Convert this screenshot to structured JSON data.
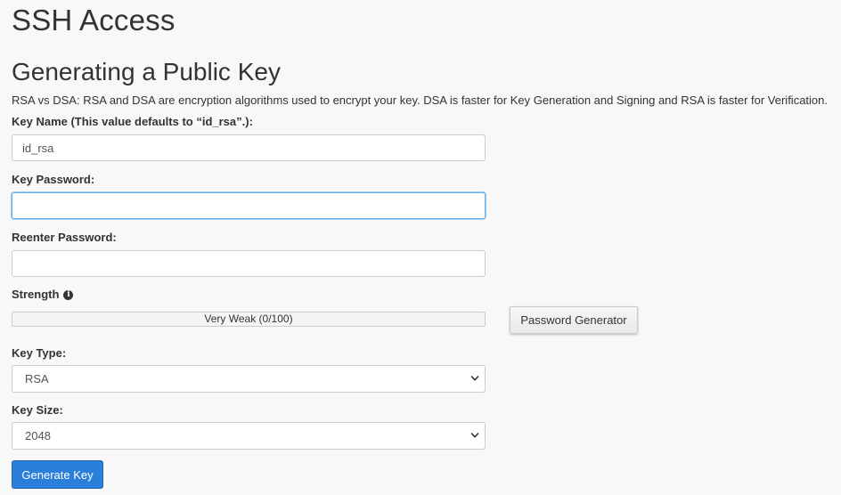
{
  "page": {
    "title": "SSH Access",
    "section_title": "Generating a Public Key",
    "description": "RSA vs DSA: RSA and DSA are encryption algorithms used to encrypt your key. DSA is faster for Key Generation and Signing and RSA is faster for Verification."
  },
  "form": {
    "key_name": {
      "label": "Key Name (This value defaults to “id_rsa”.):",
      "value": "id_rsa"
    },
    "key_password": {
      "label": "Key Password:",
      "value": ""
    },
    "reenter_password": {
      "label": "Reenter Password:",
      "value": ""
    },
    "strength": {
      "label": "Strength",
      "info_icon": "info-circle-icon",
      "meter_text": "Very Weak (0/100)",
      "score": 0,
      "max": 100
    },
    "password_generator_label": "Password Generator",
    "key_type": {
      "label": "Key Type:",
      "selected": "RSA"
    },
    "key_size": {
      "label": "Key Size:",
      "selected": "2048"
    },
    "generate_button_label": "Generate Key"
  },
  "colors": {
    "primary_button": "#2a7fdb",
    "focus_border": "#66afe9",
    "background": "#f8f8f8"
  }
}
